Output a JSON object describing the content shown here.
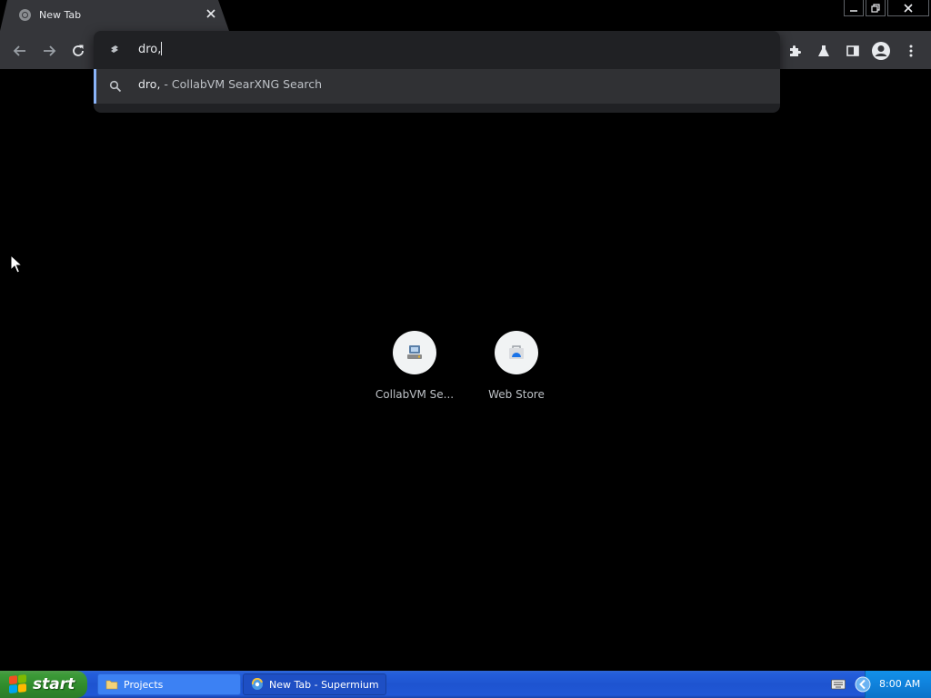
{
  "browser": {
    "tab": {
      "title": "New Tab",
      "favicon": "globe-icon",
      "close_icon": "close-icon"
    },
    "window_controls": [
      "minimize-icon",
      "restore-icon",
      "close-icon"
    ],
    "toolbar": {
      "nav": [
        "back-icon",
        "forward-icon",
        "reload-icon"
      ],
      "right_icons": [
        "extensions-icon",
        "labs-flask-icon",
        "side-panel-icon",
        "profile-avatar-icon",
        "menu-kebab-icon"
      ]
    },
    "omnibox": {
      "value": "dro,",
      "suggestion": {
        "query": "dro,",
        "description": "- CollabVM SearXNG Search",
        "icon": "search-icon"
      }
    }
  },
  "ntp": {
    "shortcuts": [
      {
        "label": "CollabVM Se...",
        "icon": "collabvm-icon"
      },
      {
        "label": "Web Store",
        "icon": "web-store-icon"
      }
    ]
  },
  "taskbar": {
    "start_label": "start",
    "items": [
      {
        "label": "Projects",
        "icon": "folder-icon"
      },
      {
        "label": "New Tab - Supermium",
        "icon": "browser-icon"
      }
    ],
    "tray_icons": [
      "keyboard-icon",
      "back-arrow-icon"
    ],
    "clock": "8:00 AM"
  },
  "colors": {
    "tab_bg": "#35363a",
    "omnibox_bg": "#202124",
    "suggestion_bg": "#303134",
    "suggestion_accent": "#8ab4f8",
    "taskbar_blue": "#245edb",
    "start_green": "#3c9a38"
  }
}
